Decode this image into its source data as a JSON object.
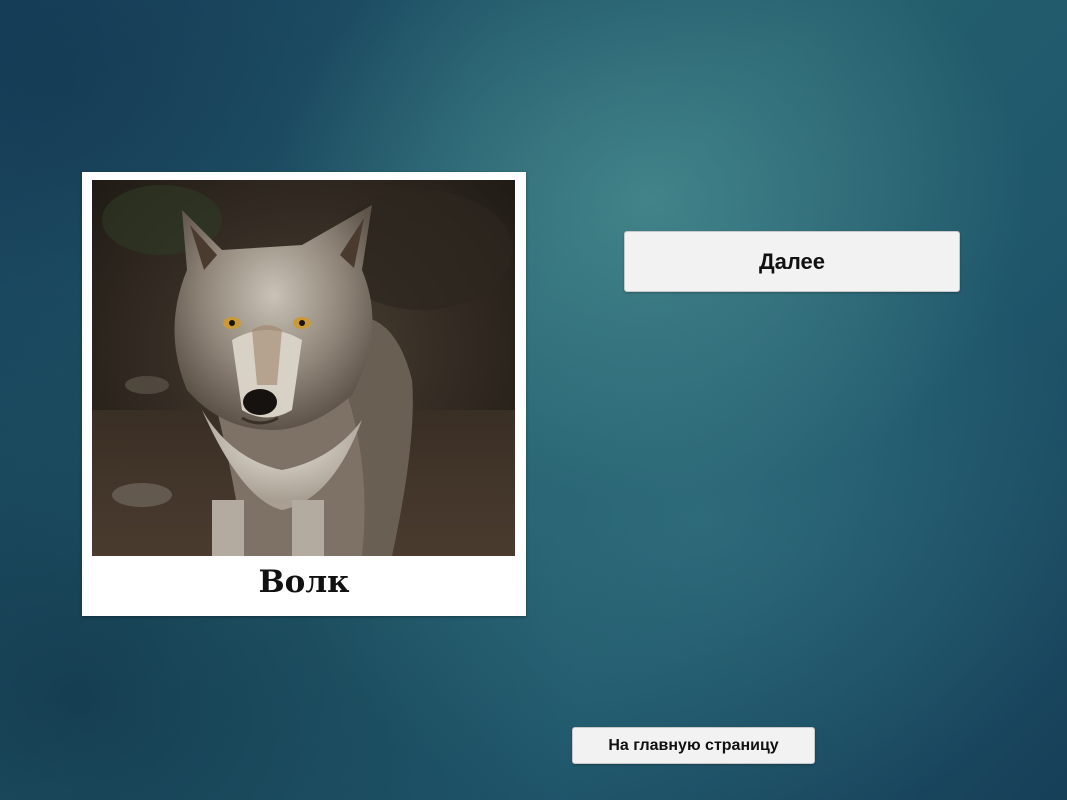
{
  "card": {
    "caption": "Волк",
    "image_subject": "wolf-photo"
  },
  "buttons": {
    "next_label": "Далее",
    "home_label": "На главную страницу"
  },
  "colors": {
    "background": "#1d4f63",
    "button_bg": "#f2f2f2",
    "card_bg": "#ffffff"
  }
}
